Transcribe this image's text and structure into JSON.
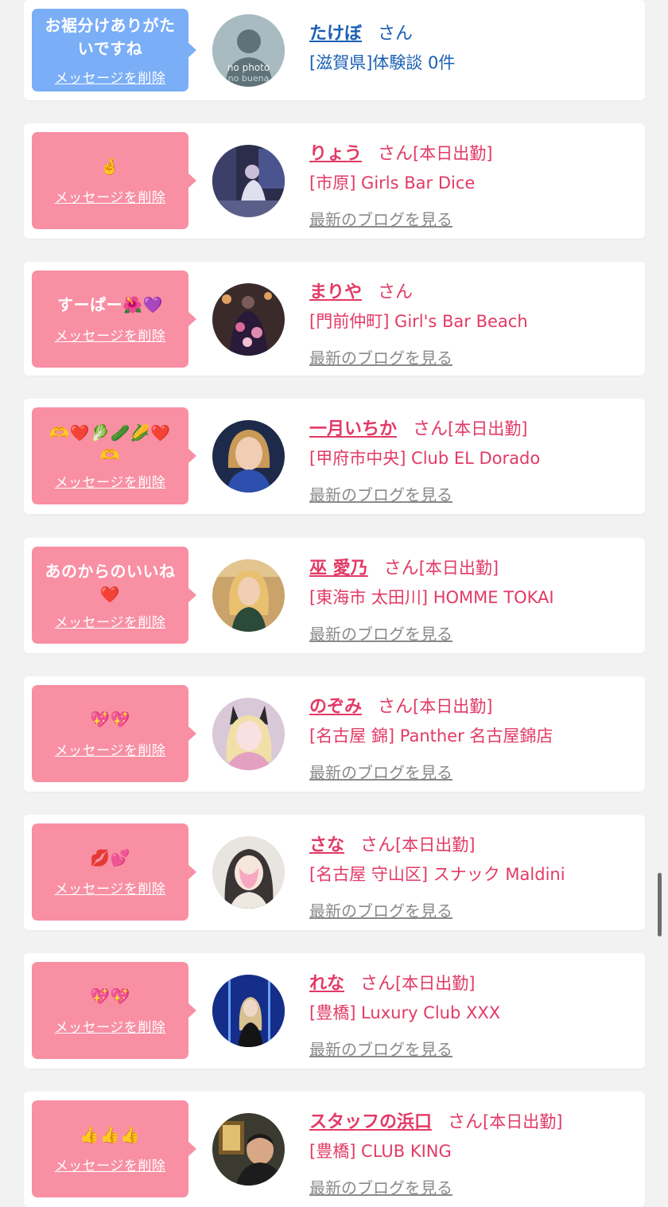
{
  "colors": {
    "pink_bubble": "#f98fa3",
    "blue_bubble": "#7aaef7",
    "name_pink": "#e23a66",
    "name_blue": "#1a5fb4",
    "blog_gray": "#8a8a8a"
  },
  "entries": [
    {
      "message": "お裾分けありがたいですね",
      "delete_label": "メッセージを削除",
      "name": "たけぼ",
      "honorific": "さん",
      "work_status": "",
      "shop": "[滋賀県]体験談 0件",
      "blog_link": "",
      "avatar": "no-photo-avatar",
      "avatar_text_1": "no photo",
      "avatar_text_2": "no buena"
    },
    {
      "message": "🤞",
      "delete_label": "メッセージを削除",
      "name": "りょう",
      "honorific": "さん",
      "work_status": "[本日出勤]",
      "shop": "[市原] Girls Bar Dice",
      "blog_link": "最新のブログを見る",
      "avatar": "user-photo-avatar"
    },
    {
      "message": "すーぱー🌺💜",
      "delete_label": "メッセージを削除",
      "name": "まりや",
      "honorific": "さん",
      "work_status": "",
      "shop": "[門前仲町] Girl's Bar Beach",
      "blog_link": "最新のブログを見る",
      "avatar": "user-photo-avatar"
    },
    {
      "message": "🫶❤️🥬🥒🌽❤️🫶",
      "delete_label": "メッセージを削除",
      "name": "一月いちか",
      "honorific": "さん",
      "work_status": "[本日出勤]",
      "shop": "[甲府市中央] Club EL Dorado",
      "blog_link": "最新のブログを見る",
      "avatar": "user-photo-avatar"
    },
    {
      "message": "あのからのいいね❤️",
      "delete_label": "メッセージを削除",
      "name": "巫 愛乃",
      "honorific": "さん",
      "work_status": "[本日出勤]",
      "shop": "[東海市 太田川] HOMME TOKAI",
      "blog_link": "最新のブログを見る",
      "avatar": "user-photo-avatar"
    },
    {
      "message": "💖💖",
      "delete_label": "メッセージを削除",
      "name": "のぞみ",
      "honorific": "さん",
      "work_status": "[本日出勤]",
      "shop": "[名古屋 錦] Panther 名古屋錦店",
      "blog_link": "最新のブログを見る",
      "avatar": "user-photo-avatar"
    },
    {
      "message": "💋💕",
      "delete_label": "メッセージを削除",
      "name": "さな",
      "honorific": "さん",
      "work_status": "[本日出勤]",
      "shop": "[名古屋 守山区] スナック Maldini",
      "blog_link": "最新のブログを見る",
      "avatar": "user-photo-avatar"
    },
    {
      "message": "💖💖",
      "delete_label": "メッセージを削除",
      "name": "れな",
      "honorific": "さん",
      "work_status": "[本日出勤]",
      "shop": "[豊橋] Luxury Club XXX",
      "blog_link": "最新のブログを見る",
      "avatar": "user-photo-avatar"
    },
    {
      "message": "👍👍👍",
      "delete_label": "メッセージを削除",
      "name": "スタッフの浜口",
      "honorific": "さん",
      "work_status": "[本日出勤]",
      "shop": "[豊橋] CLUB KING",
      "blog_link": "最新のブログを見る",
      "avatar": "user-photo-avatar"
    }
  ]
}
